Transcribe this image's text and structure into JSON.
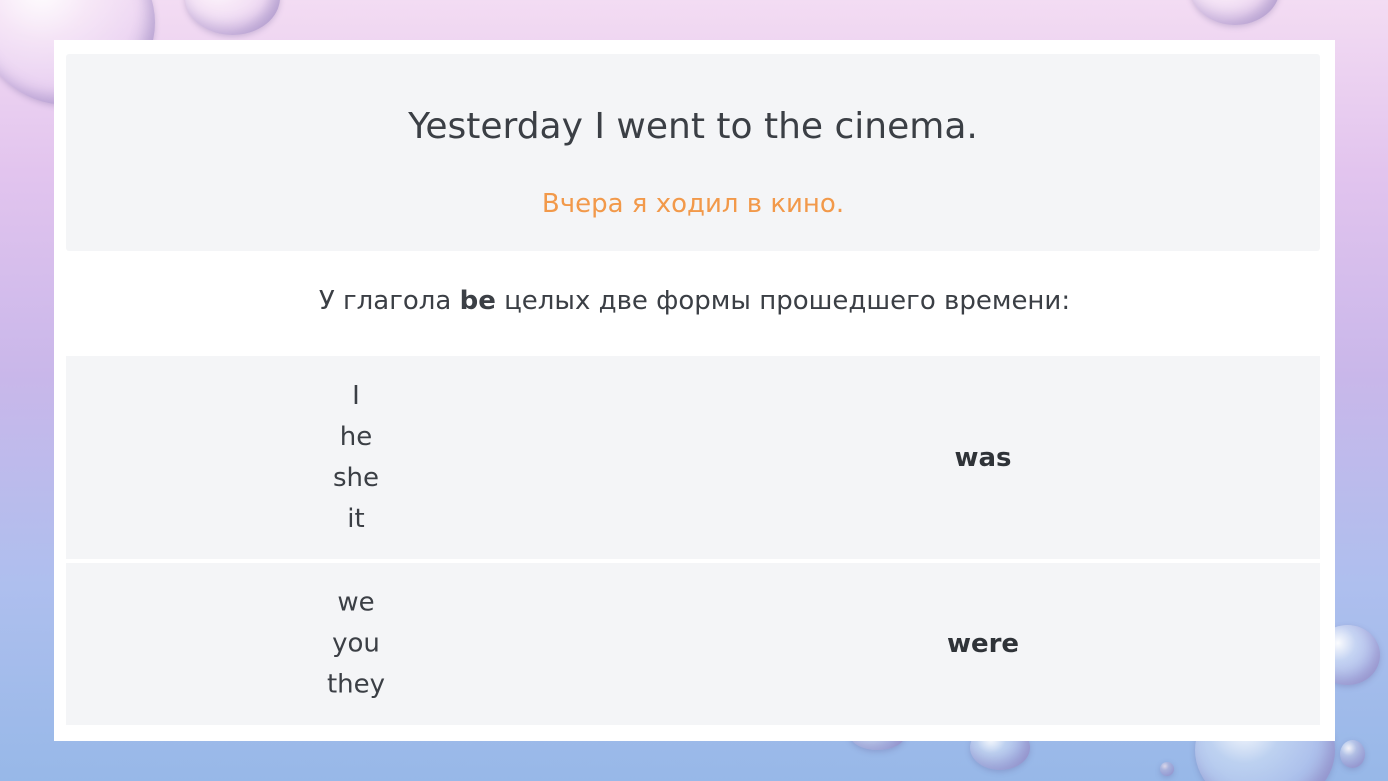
{
  "example": {
    "sentence": "Yesterday I went to the cinema.",
    "translation": "Вчера я ходил в кино."
  },
  "note": {
    "before": "У глагола ",
    "verb": "be",
    "after": " целых две формы прошедшего времени:"
  },
  "table": {
    "rows": [
      {
        "pronouns": [
          "I",
          "he",
          "she",
          "it"
        ],
        "form": "was"
      },
      {
        "pronouns": [
          "we",
          "you",
          "they"
        ],
        "form": "were"
      }
    ]
  },
  "colors": {
    "translation": "#f2994a",
    "panel": "#f4f5f7",
    "text": "#3b3f45"
  }
}
